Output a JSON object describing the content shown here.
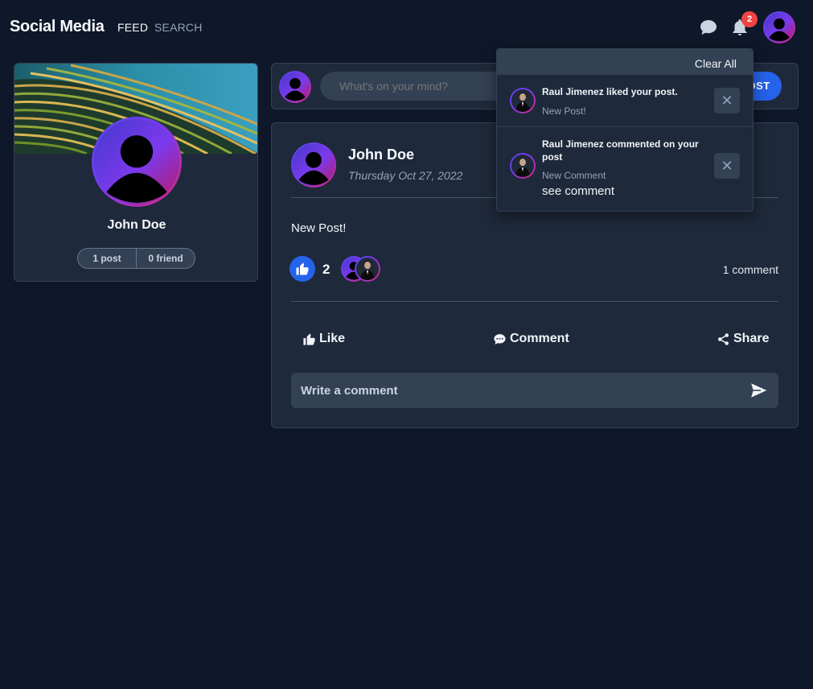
{
  "nav": {
    "brand": "Social Media",
    "links": [
      "FEED",
      "SEARCH"
    ],
    "notification_count": "2",
    "icons": [
      "chat-icon",
      "bell-icon",
      "avatar"
    ]
  },
  "profile": {
    "name": "John Doe",
    "posts": "1 post",
    "friends": "0 friend"
  },
  "composer": {
    "placeholder": "What's on your mind?",
    "post_label": "POST"
  },
  "post": {
    "author": "John Doe",
    "date": "Thursday Oct 27, 2022",
    "text": "New Post!",
    "like_count": "2",
    "comment_count": "1 comment",
    "actions": [
      "Like",
      "Comment",
      "Share"
    ],
    "comment_placeholder": "Write a comment"
  },
  "notifications": {
    "clear_all": "Clear All",
    "items": [
      {
        "text": "Raul Jimenez liked your post.",
        "sub": "New Post!",
        "link": ""
      },
      {
        "text": "Raul Jimenez commented on your post",
        "sub": "New Comment",
        "link": "see comment"
      }
    ]
  },
  "colors": {
    "background": "#0f172a",
    "card": "#1e293b",
    "accent": "#2563eb",
    "badge": "#ef4444"
  }
}
